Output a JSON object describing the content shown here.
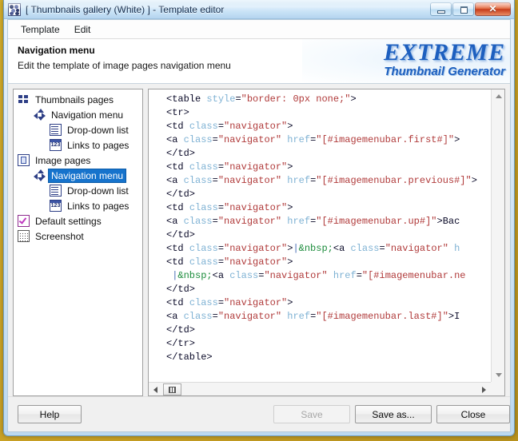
{
  "window": {
    "title": "[ Thumbnails gallery (White) ] - Template editor",
    "icon_name": "app-icon",
    "minimize_label": "–",
    "maximize_label": "□",
    "close_label": "✕"
  },
  "menubar": {
    "items": [
      {
        "label": "Template"
      },
      {
        "label": "Edit"
      }
    ]
  },
  "header": {
    "title": "Navigation menu",
    "subtitle": "Edit the template of image pages navigation menu",
    "logo_main": "EXTREME",
    "logo_sub": "Thumbnail Generator"
  },
  "tree": {
    "items": [
      {
        "label": "Thumbnails pages",
        "level": 0,
        "icon": "grid-icon",
        "selected": false
      },
      {
        "label": "Navigation menu",
        "level": 1,
        "icon": "nav-arrows-icon",
        "selected": false
      },
      {
        "label": "Drop-down list",
        "level": 2,
        "icon": "list-icon",
        "selected": false
      },
      {
        "label": "Links to pages",
        "level": 2,
        "icon": "numbers-icon",
        "selected": false
      },
      {
        "label": "Image pages",
        "level": 0,
        "icon": "page-icon",
        "selected": false
      },
      {
        "label": "Navigation menu",
        "level": 1,
        "icon": "nav-arrows-icon",
        "selected": true
      },
      {
        "label": "Drop-down list",
        "level": 2,
        "icon": "list-icon",
        "selected": false
      },
      {
        "label": "Links to pages",
        "level": 2,
        "icon": "numbers-icon",
        "selected": false
      },
      {
        "label": "Default settings",
        "level": 0,
        "icon": "checkbox-icon",
        "selected": false
      },
      {
        "label": "Screenshot",
        "level": 0,
        "icon": "screenshot-icon",
        "selected": false
      }
    ]
  },
  "editor": {
    "lines": [
      [
        {
          "t": "tag",
          "s": "<table "
        },
        {
          "t": "attr",
          "s": "style"
        },
        {
          "t": "tag",
          "s": "="
        },
        {
          "t": "val",
          "s": "\"border: 0px none;\""
        },
        {
          "t": "tag",
          "s": ">"
        }
      ],
      [
        {
          "t": "tag",
          "s": "<tr>"
        }
      ],
      [
        {
          "t": "tag",
          "s": "<td "
        },
        {
          "t": "attr",
          "s": "class"
        },
        {
          "t": "tag",
          "s": "="
        },
        {
          "t": "val",
          "s": "\"navigator\""
        },
        {
          "t": "tag",
          "s": ">"
        }
      ],
      [
        {
          "t": "tag",
          "s": "<a "
        },
        {
          "t": "attr",
          "s": "class"
        },
        {
          "t": "tag",
          "s": "="
        },
        {
          "t": "val",
          "s": "\"navigator\""
        },
        {
          "t": "tag",
          "s": " "
        },
        {
          "t": "attr",
          "s": "href"
        },
        {
          "t": "tag",
          "s": "="
        },
        {
          "t": "val",
          "s": "\"[#imagemenubar.first#]\""
        },
        {
          "t": "tag",
          "s": ">"
        }
      ],
      [
        {
          "t": "tag",
          "s": "</td>"
        }
      ],
      [
        {
          "t": "tag",
          "s": "<td "
        },
        {
          "t": "attr",
          "s": "class"
        },
        {
          "t": "tag",
          "s": "="
        },
        {
          "t": "val",
          "s": "\"navigator\""
        },
        {
          "t": "tag",
          "s": ">"
        }
      ],
      [
        {
          "t": "tag",
          "s": "<a "
        },
        {
          "t": "attr",
          "s": "class"
        },
        {
          "t": "tag",
          "s": "="
        },
        {
          "t": "val",
          "s": "\"navigator\""
        },
        {
          "t": "tag",
          "s": " "
        },
        {
          "t": "attr",
          "s": "href"
        },
        {
          "t": "tag",
          "s": "="
        },
        {
          "t": "val",
          "s": "\"[#imagemenubar.previous#]\""
        },
        {
          "t": "tag",
          "s": ">"
        }
      ],
      [
        {
          "t": "tag",
          "s": "</td>"
        }
      ],
      [
        {
          "t": "tag",
          "s": "<td "
        },
        {
          "t": "attr",
          "s": "class"
        },
        {
          "t": "tag",
          "s": "="
        },
        {
          "t": "val",
          "s": "\"navigator\""
        },
        {
          "t": "tag",
          "s": ">"
        }
      ],
      [
        {
          "t": "tag",
          "s": "<a "
        },
        {
          "t": "attr",
          "s": "class"
        },
        {
          "t": "tag",
          "s": "="
        },
        {
          "t": "val",
          "s": "\"navigator\""
        },
        {
          "t": "tag",
          "s": " "
        },
        {
          "t": "attr",
          "s": "href"
        },
        {
          "t": "tag",
          "s": "="
        },
        {
          "t": "val",
          "s": "\"[#imagemenubar.up#]\""
        },
        {
          "t": "tag",
          "s": ">"
        },
        {
          "t": "txt",
          "s": "Bac"
        }
      ],
      [
        {
          "t": "tag",
          "s": "</td>"
        }
      ],
      [
        {
          "t": "tag",
          "s": "<td "
        },
        {
          "t": "attr",
          "s": "class"
        },
        {
          "t": "tag",
          "s": "="
        },
        {
          "t": "val",
          "s": "\"navigator\""
        },
        {
          "t": "tag",
          "s": ">"
        },
        {
          "t": "pipe",
          "s": "|"
        },
        {
          "t": "ent",
          "s": "&nbsp;"
        },
        {
          "t": "tag",
          "s": "<a "
        },
        {
          "t": "attr",
          "s": "class"
        },
        {
          "t": "tag",
          "s": "="
        },
        {
          "t": "val",
          "s": "\"navigator\""
        },
        {
          "t": "tag",
          "s": " "
        },
        {
          "t": "attr",
          "s": "h"
        }
      ],
      [
        {
          "t": "tag",
          "s": "<td "
        },
        {
          "t": "attr",
          "s": "class"
        },
        {
          "t": "tag",
          "s": "="
        },
        {
          "t": "val",
          "s": "\"navigator\""
        },
        {
          "t": "tag",
          "s": ">"
        }
      ],
      [
        {
          "t": "pipe",
          "s": " |"
        },
        {
          "t": "ent",
          "s": "&nbsp;"
        },
        {
          "t": "tag",
          "s": "<a "
        },
        {
          "t": "attr",
          "s": "class"
        },
        {
          "t": "tag",
          "s": "="
        },
        {
          "t": "val",
          "s": "\"navigator\""
        },
        {
          "t": "tag",
          "s": " "
        },
        {
          "t": "attr",
          "s": "href"
        },
        {
          "t": "tag",
          "s": "="
        },
        {
          "t": "val",
          "s": "\"[#imagemenubar.ne"
        }
      ],
      [
        {
          "t": "tag",
          "s": "</td>"
        }
      ],
      [
        {
          "t": "tag",
          "s": "<td "
        },
        {
          "t": "attr",
          "s": "class"
        },
        {
          "t": "tag",
          "s": "="
        },
        {
          "t": "val",
          "s": "\"navigator\""
        },
        {
          "t": "tag",
          "s": ">"
        }
      ],
      [
        {
          "t": "tag",
          "s": "<a "
        },
        {
          "t": "attr",
          "s": "class"
        },
        {
          "t": "tag",
          "s": "="
        },
        {
          "t": "val",
          "s": "\"navigator\""
        },
        {
          "t": "tag",
          "s": " "
        },
        {
          "t": "attr",
          "s": "href"
        },
        {
          "t": "tag",
          "s": "="
        },
        {
          "t": "val",
          "s": "\"[#imagemenubar.last#]\""
        },
        {
          "t": "tag",
          "s": ">"
        },
        {
          "t": "txt",
          "s": "I"
        }
      ],
      [
        {
          "t": "tag",
          "s": "</td>"
        }
      ],
      [
        {
          "t": "tag",
          "s": "</tr>"
        }
      ],
      [
        {
          "t": "tag",
          "s": "</table>"
        }
      ]
    ],
    "vscroll": {
      "up": "▲",
      "down": "▼"
    },
    "hscroll": {
      "left": "◀",
      "right": "▶"
    }
  },
  "footer": {
    "help_label": "Help",
    "save_label": "Save",
    "save_as_label": "Save as...",
    "close_label": "Close"
  },
  "colors": {
    "selection": "#1673cc",
    "logo": "#1d5fbf",
    "tag": "#0a0a28",
    "attribute": "#7fb2d4",
    "value": "#b03a3a",
    "entity": "#1c8c3c",
    "desktop": "#c8a024"
  }
}
